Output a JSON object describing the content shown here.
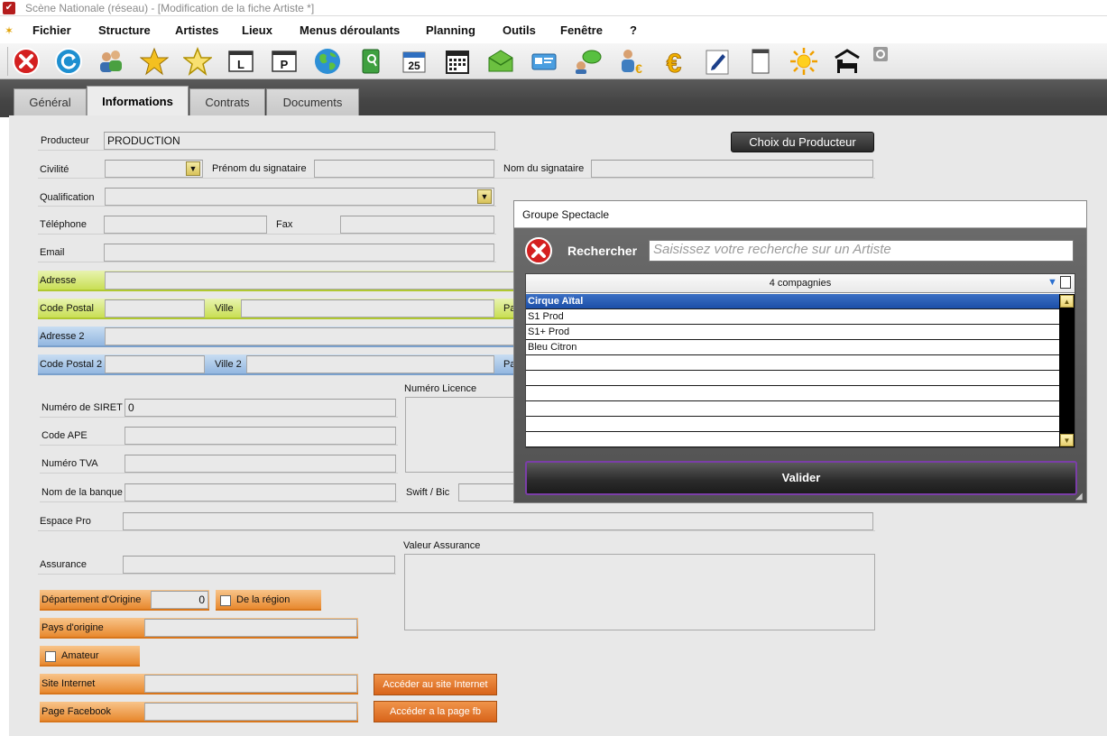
{
  "window": {
    "title": "Scène Nationale (réseau) - [Modification de la fiche Artiste *]"
  },
  "menu": [
    "Fichier",
    "Structure",
    "Artistes",
    "Lieux",
    "Menus déroulants",
    "Planning",
    "Outils",
    "Fenêtre",
    "?"
  ],
  "toolbar": {
    "icons": [
      "close-icon",
      "refresh-icon",
      "users-icon",
      "star-icon",
      "star-outline-icon",
      "l-badge-icon",
      "p-badge-icon",
      "globe-icon",
      "book-icon",
      "calendar-icon",
      "calendar-grid-icon",
      "envelope-icon",
      "card-icon",
      "chat-icon",
      "person-euro-icon",
      "euro-icon",
      "pen-icon",
      "document-icon",
      "sun-icon",
      "bed-icon",
      "settings-icon"
    ],
    "calendar_day": "25",
    "badge_l": "L",
    "badge_p": "P"
  },
  "tabs": [
    "Général",
    "Informations",
    "Contrats",
    "Documents"
  ],
  "active_tab": "Informations",
  "form": {
    "producteur_label": "Producteur",
    "producteur_value": "PRODUCTION",
    "choix_producteur": "Choix du Producteur",
    "civilite_label": "Civilité",
    "prenom_signataire_label": "Prénom du signataire",
    "nom_signataire_label": "Nom du signataire",
    "qualification_label": "Qualification",
    "telephone_label": "Téléphone",
    "fax_label": "Fax",
    "email_label": "Email",
    "adresse_label": "Adresse",
    "code_postal_label": "Code Postal",
    "ville_label": "Ville",
    "pays_truncated": "Pa",
    "adresse2_label": "Adresse 2",
    "code_postal2_label": "Code Postal 2",
    "ville2_label": "Ville 2",
    "pays2_truncated": "Pa",
    "siret_label": "Numéro de SIRET",
    "siret_value": "0",
    "licence_label": "Numéro Licence",
    "ape_label": "Code APE",
    "tva_label": "Numéro TVA",
    "banque_label": "Nom de la banque",
    "swift_label": "Swift / Bic",
    "espace_pro_label": "Espace Pro",
    "assurance_label": "Assurance",
    "valeur_assurance_label": "Valeur Assurance",
    "departement_label": "Département d'Origine",
    "departement_value": "0",
    "de_la_region_label": "De la région",
    "pays_origine_label": "Pays d'origine",
    "amateur_label": "Amateur",
    "site_label": "Site Internet",
    "site_button": "Accéder au site Internet",
    "facebook_label": "Page Facebook",
    "facebook_button": "Accéder a la page fb"
  },
  "dialog": {
    "title": "Groupe Spectacle",
    "search_label": "Rechercher",
    "search_placeholder": "Saisissez votre recherche sur un Artiste",
    "list_header": "4 compagnies",
    "items": [
      "Cirque Aïtal",
      "S1 Prod",
      "S1+ Prod",
      "Bleu Citron"
    ],
    "selected_index": 0,
    "empty_rows": 6,
    "validate": "Valider"
  },
  "colors": {
    "adresse_band": "#c9df55",
    "adresse2_band": "#93b7e0",
    "origine_band": "#e8892f",
    "selection": "#1c4fa8",
    "valider_border": "#7b3ea8"
  }
}
